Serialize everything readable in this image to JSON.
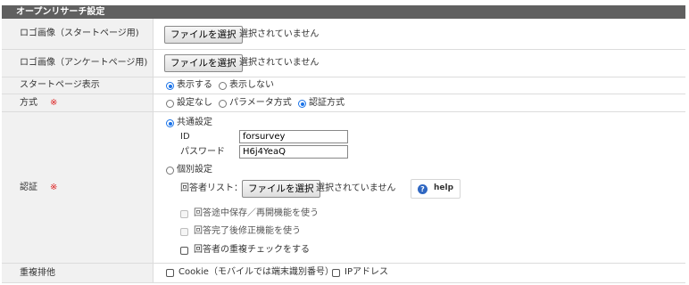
{
  "header": {
    "title": "オープンリサーチ設定"
  },
  "logo_start": {
    "label": "ロゴ画像（スタートページ用)",
    "button": "ファイルを選択",
    "status": "選択されていません"
  },
  "logo_end": {
    "label": "ロゴ画像（アンケートページ用)",
    "button": "ファイルを選択",
    "status": "選択されていません"
  },
  "start_page": {
    "label": "スタートページ表示",
    "options": [
      {
        "label": "表示する",
        "selected": true
      },
      {
        "label": "表示しない",
        "selected": false
      }
    ]
  },
  "method": {
    "label": "方式",
    "required_mark": "※",
    "options": [
      {
        "label": "設定なし",
        "selected": false
      },
      {
        "label": "パラメータ方式",
        "selected": false
      },
      {
        "label": "認証方式",
        "selected": true
      }
    ]
  },
  "auth": {
    "label": "認証",
    "required_mark": "※",
    "common": {
      "label": "共通設定",
      "selected": true,
      "id_label": "ID",
      "id_value": "forsurvey",
      "password_label": "パスワード",
      "password_value": "H6j4YeaQ"
    },
    "individual": {
      "label": "個別設定",
      "selected": false,
      "respondent_label": "回答者リスト：",
      "button": "ファイルを選択",
      "status": "選択されていません",
      "help": "help",
      "checks": [
        {
          "label": "回答途中保存／再開機能を使う",
          "disabled": true
        },
        {
          "label": "回答完了後修正機能を使う",
          "disabled": true
        },
        {
          "label": "回答者の重複チェックをする",
          "disabled": false
        }
      ]
    }
  },
  "dedupe": {
    "label": "重複排他",
    "options": [
      {
        "label": "Cookie（モバイルでは端末識別番号）"
      },
      {
        "label": "IPアドレス"
      }
    ]
  }
}
